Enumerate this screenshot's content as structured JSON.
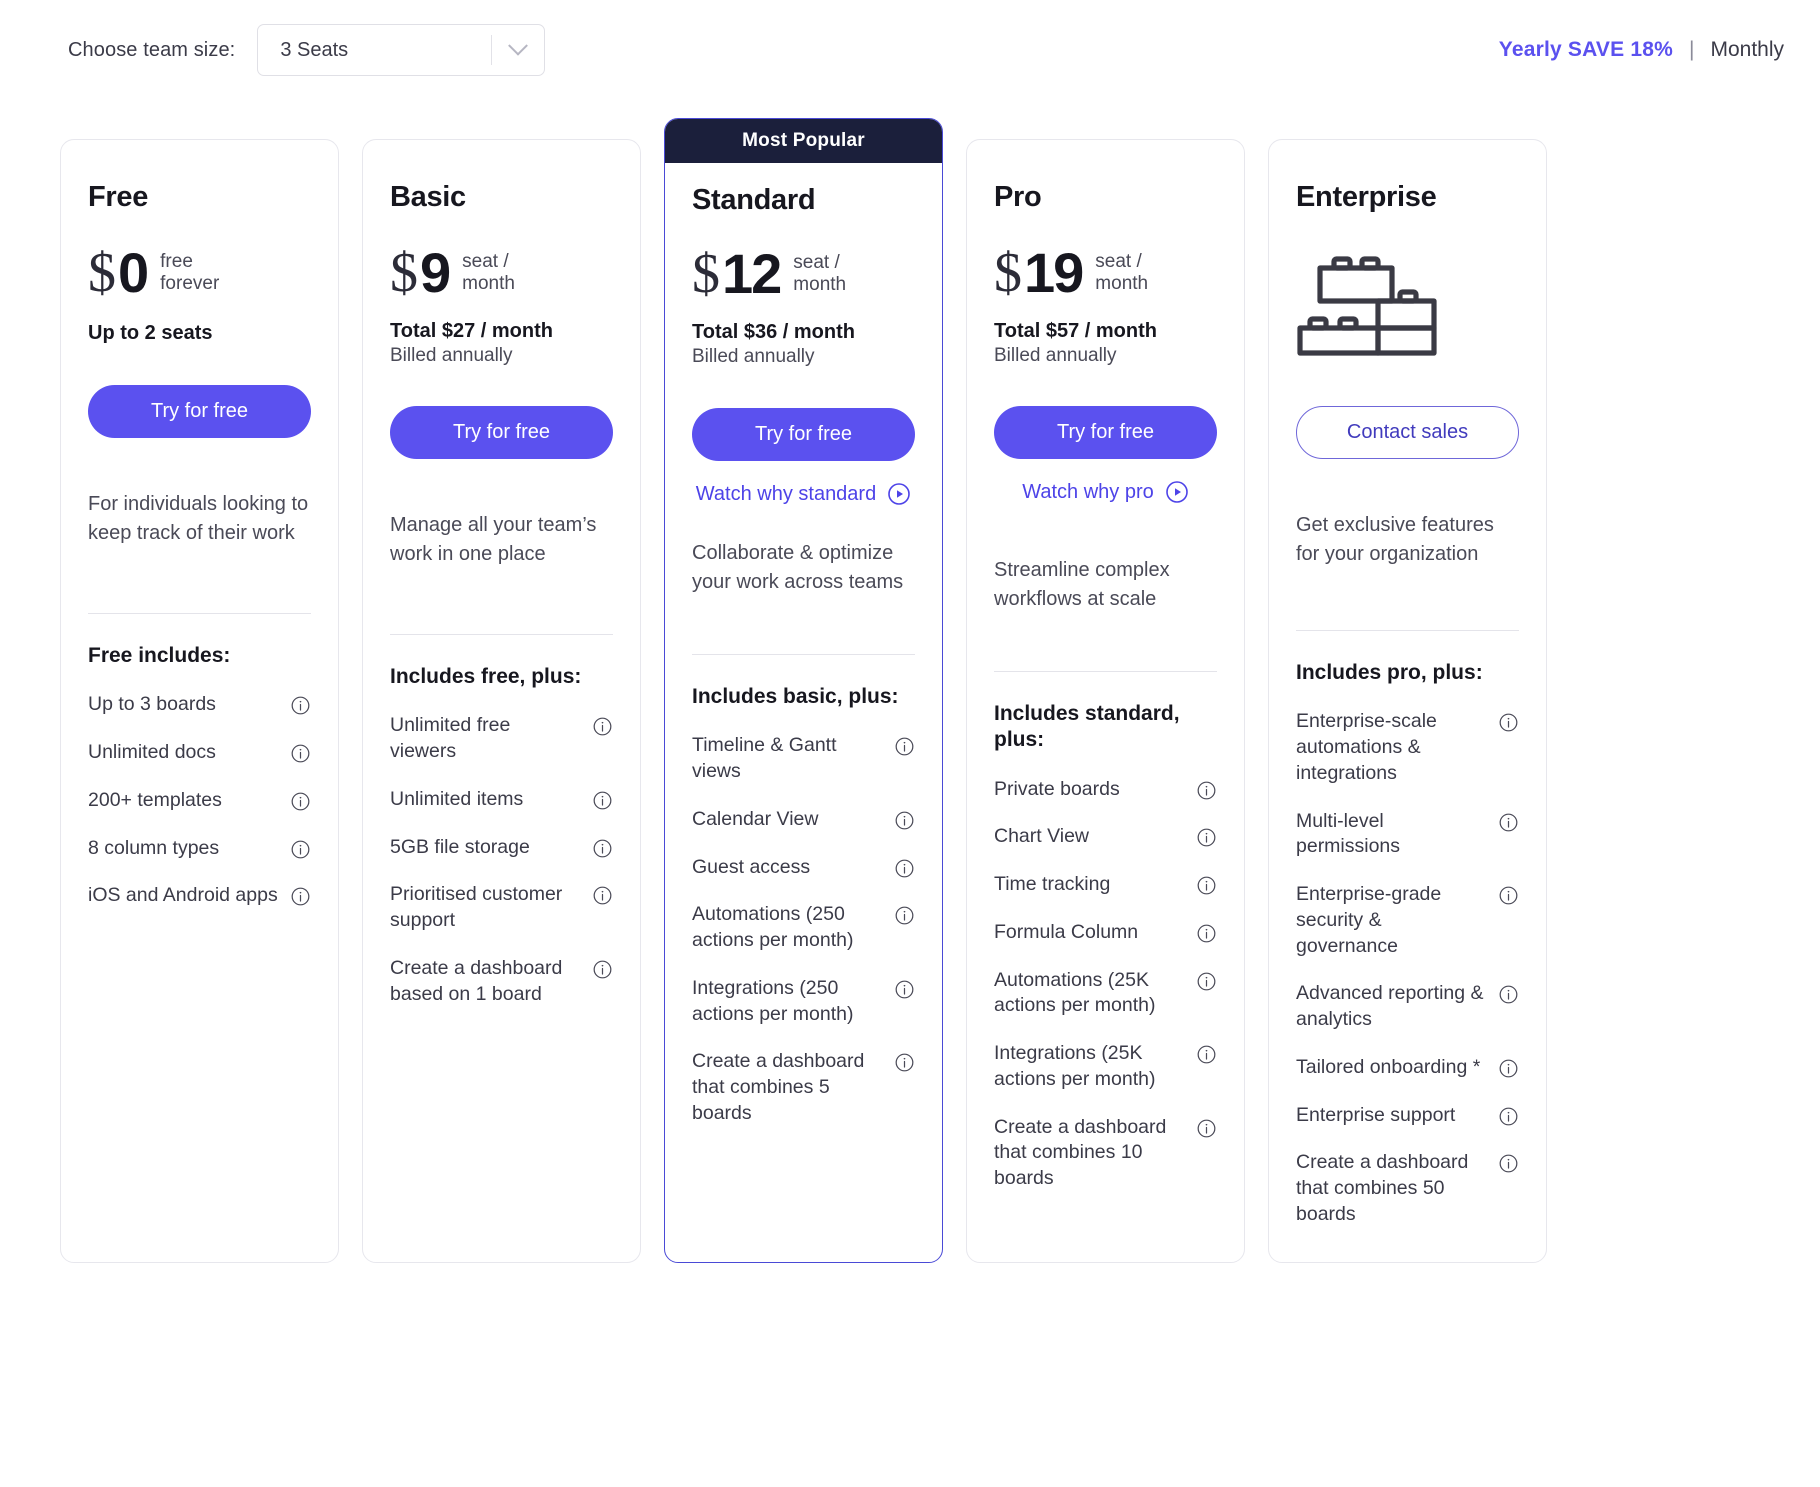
{
  "header": {
    "team_size_label": "Choose team size:",
    "team_size_value": "3 Seats",
    "team_size_placeholder": "3 Seats",
    "billing_yearly": "Yearly SAVE 18%",
    "billing_separator": "|",
    "billing_monthly": "Monthly",
    "accent_color": "#5b51ef",
    "banner_color": "#1b1f3b"
  },
  "plans": [
    {
      "name": "Free",
      "currency": "$",
      "amount": "0",
      "per": "free\nforever",
      "seats": "Up to 2 seats",
      "cta": "Try for free",
      "tagline": "For individuals looking to keep track of their work",
      "includes_title": "Free includes:",
      "features": [
        "Up to 3 boards",
        "Unlimited docs",
        "200+ templates",
        "8 column types",
        "iOS and Android apps"
      ]
    },
    {
      "name": "Basic",
      "currency": "$",
      "amount": "9",
      "per": "seat /\nmonth",
      "total": "Total $27 / month",
      "billed": "Billed annually",
      "cta": "Try for free",
      "tagline": "Manage all your team’s work in one place",
      "includes_title": "Includes free, plus:",
      "features": [
        "Unlimited free viewers",
        "Unlimited items",
        "5GB file storage",
        "Prioritised customer support",
        "Create a dashboard based on 1 board"
      ]
    },
    {
      "name": "Standard",
      "badge": "Most Popular",
      "currency": "$",
      "amount": "12",
      "per": "seat /\nmonth",
      "total": "Total $36 / month",
      "billed": "Billed annually",
      "cta": "Try for free",
      "watch": "Watch why standard",
      "tagline": "Collaborate & optimize your work across teams",
      "includes_title": "Includes basic, plus:",
      "features": [
        "Timeline & Gantt views",
        "Calendar View",
        "Guest access",
        "Automations (250 actions per month)",
        "Integrations (250 actions per month)",
        "Create a dashboard that combines 5 boards"
      ]
    },
    {
      "name": "Pro",
      "currency": "$",
      "amount": "19",
      "per": "seat /\nmonth",
      "total": "Total $57 / month",
      "billed": "Billed annually",
      "cta": "Try for free",
      "watch": "Watch why pro",
      "tagline": "Streamline complex workflows at scale",
      "includes_title": "Includes standard, plus:",
      "features": [
        "Private boards",
        "Chart View",
        "Time tracking",
        "Formula Column",
        "Automations (25K actions per month)",
        "Integrations (25K actions per month)",
        "Create a dashboard that combines 10 boards"
      ]
    },
    {
      "name": "Enterprise",
      "icon": "lego-blocks-icon",
      "cta": "Contact sales",
      "tagline": "Get exclusive features for your organization",
      "includes_title": "Includes pro, plus:",
      "features": [
        "Enterprise-scale automations & integrations",
        "Multi-level permissions",
        "Enterprise-grade security & governance",
        "Advanced reporting & analytics",
        "Tailored onboarding *",
        "Enterprise support",
        "Create a dashboard that combines 50 boards"
      ]
    }
  ]
}
